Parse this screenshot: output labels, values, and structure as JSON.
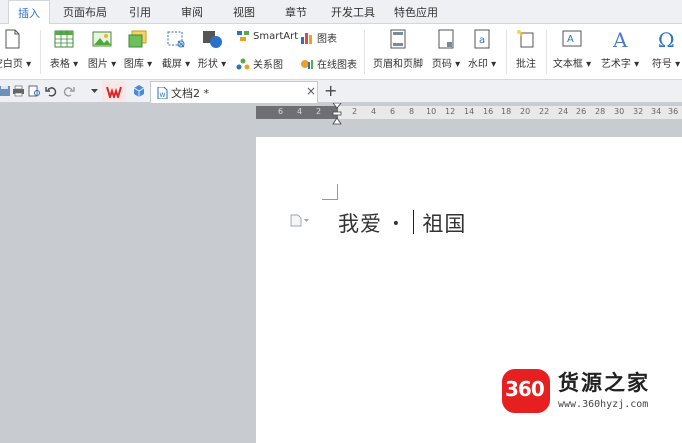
{
  "menu": {
    "tabs": [
      {
        "label": "插入",
        "active": true
      },
      {
        "label": "页面布局"
      },
      {
        "label": "引用"
      },
      {
        "label": "审阅"
      },
      {
        "label": "视图"
      },
      {
        "label": "章节"
      },
      {
        "label": "开发工具"
      },
      {
        "label": "特色应用"
      }
    ]
  },
  "ribbon": {
    "blank_page": "空白页",
    "table": "表格",
    "picture": "图片",
    "gallery": "图库",
    "screenshot": "截屏",
    "shapes": "形状",
    "smartart": "SmartArt",
    "chart": "图表",
    "relation": "关系图",
    "online_chart": "在线图表",
    "header_footer": "页眉和页脚",
    "page_number": "页码",
    "watermark": "水印",
    "comment": "批注",
    "textbox": "文本框",
    "wordart": "艺术字",
    "symbol": "符号"
  },
  "document_tab": {
    "title": "文档2 *",
    "close_glyph": "×",
    "add_glyph": "+"
  },
  "ruler": {
    "left_numbers": [
      "6",
      "4",
      "2"
    ],
    "right_numbers": [
      "2",
      "4",
      "6",
      "8",
      "10",
      "12",
      "14",
      "16",
      "18",
      "20",
      "22",
      "24",
      "26",
      "28",
      "30",
      "32",
      "34",
      "36"
    ]
  },
  "document": {
    "text_before": "我爱",
    "bullet": "•",
    "text_after": "祖国"
  },
  "watermark_logo": {
    "number": "360",
    "brand": "货源之家",
    "url": "www.360hyzj.com"
  },
  "colors": {
    "accent": "#2a72c8",
    "logo_red": "#e62020"
  }
}
